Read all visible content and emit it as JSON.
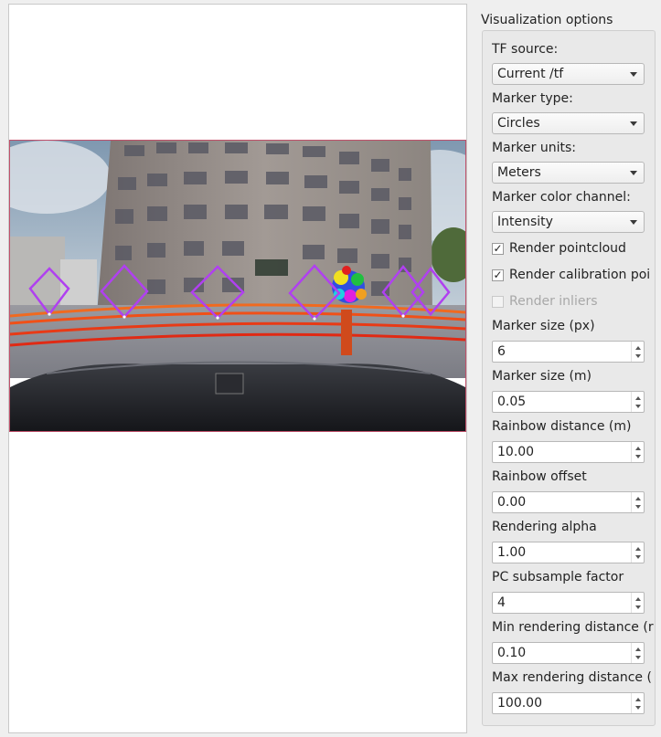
{
  "panel": {
    "title": "Visualization options",
    "tf_source_label": "TF source:",
    "tf_source_value": "Current /tf",
    "marker_type_label": "Marker type:",
    "marker_type_value": "Circles",
    "marker_units_label": "Marker units:",
    "marker_units_value": "Meters",
    "marker_color_label": "Marker color channel:",
    "marker_color_value": "Intensity",
    "render_pointcloud": {
      "label": "Render pointcloud",
      "checked": true
    },
    "render_calibration": {
      "label": "Render calibration poi",
      "checked": true
    },
    "render_inliers": {
      "label": "Render inliers",
      "checked": false,
      "enabled": false
    },
    "marker_size_px_label": "Marker size (px)",
    "marker_size_px_value": "6",
    "marker_size_m_label": "Marker size (m)",
    "marker_size_m_value": "0.05",
    "rainbow_distance_label": "Rainbow distance (m)",
    "rainbow_distance_value": "10.00",
    "rainbow_offset_label": "Rainbow offset",
    "rainbow_offset_value": "0.00",
    "rendering_alpha_label": "Rendering alpha",
    "rendering_alpha_value": "1.00",
    "pc_subsample_label": "PC subsample factor",
    "pc_subsample_value": "4",
    "min_distance_label": "Min rendering distance (r",
    "min_distance_value": "0.10",
    "max_distance_label": "Max rendering distance (",
    "max_distance_value": "100.00"
  },
  "colors": {
    "marker_diamond": "#b040f0",
    "frame_border": "#c0506a"
  }
}
